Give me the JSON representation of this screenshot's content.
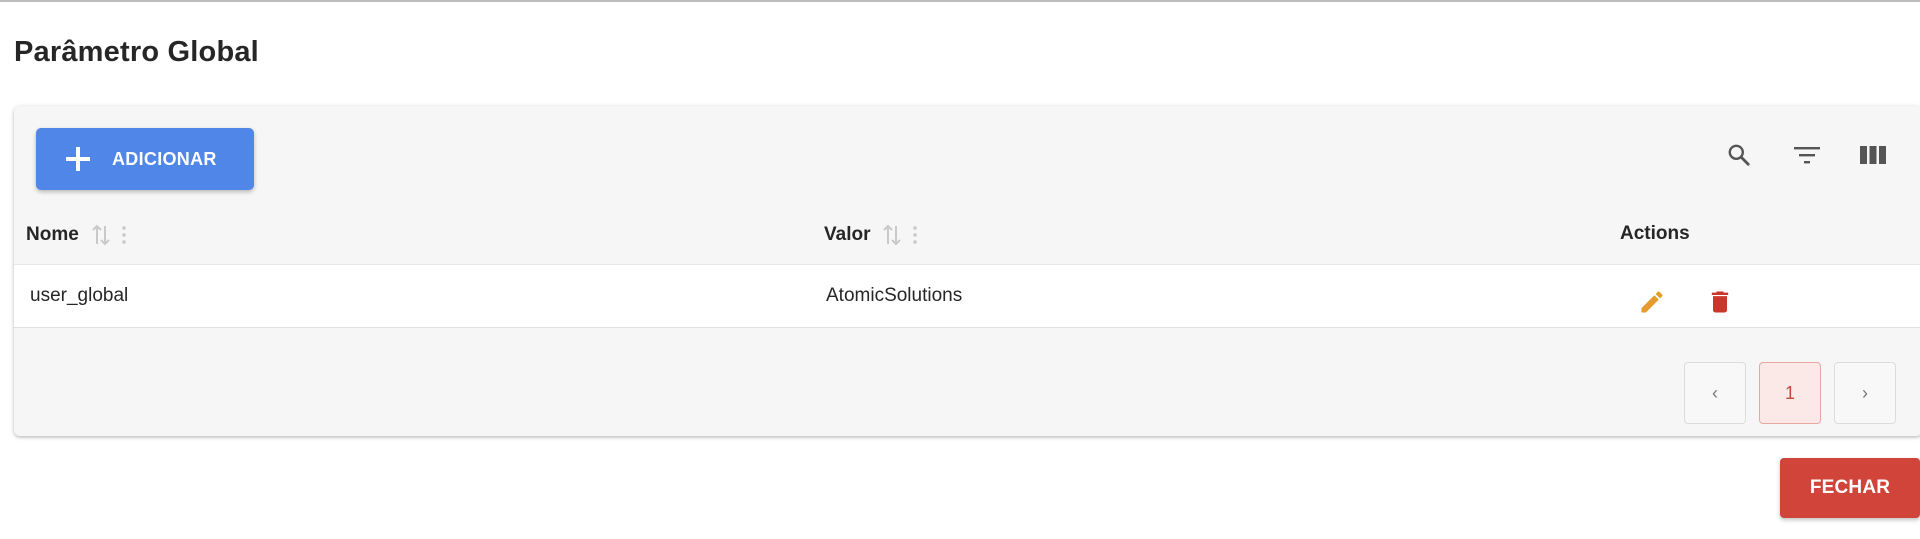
{
  "page": {
    "title": "Parâmetro Global"
  },
  "toolbar": {
    "add_label": "ADICIONAR",
    "icons": [
      "search-icon",
      "filter-icon",
      "columns-icon"
    ]
  },
  "table": {
    "columns": [
      "Nome",
      "Valor",
      "Actions"
    ],
    "rows": [
      {
        "nome": "user_global",
        "valor": "AtomicSolutions",
        "actions": [
          "edit-icon",
          "delete-icon"
        ]
      }
    ]
  },
  "pagination": {
    "prev": "‹",
    "current": "1",
    "next": "›"
  },
  "footer": {
    "close_label": "FECHAR"
  },
  "colors": {
    "primary": "#4f86e8",
    "danger": "#d0443a",
    "edit": "#e49a2c",
    "delete": "#c9372c"
  }
}
